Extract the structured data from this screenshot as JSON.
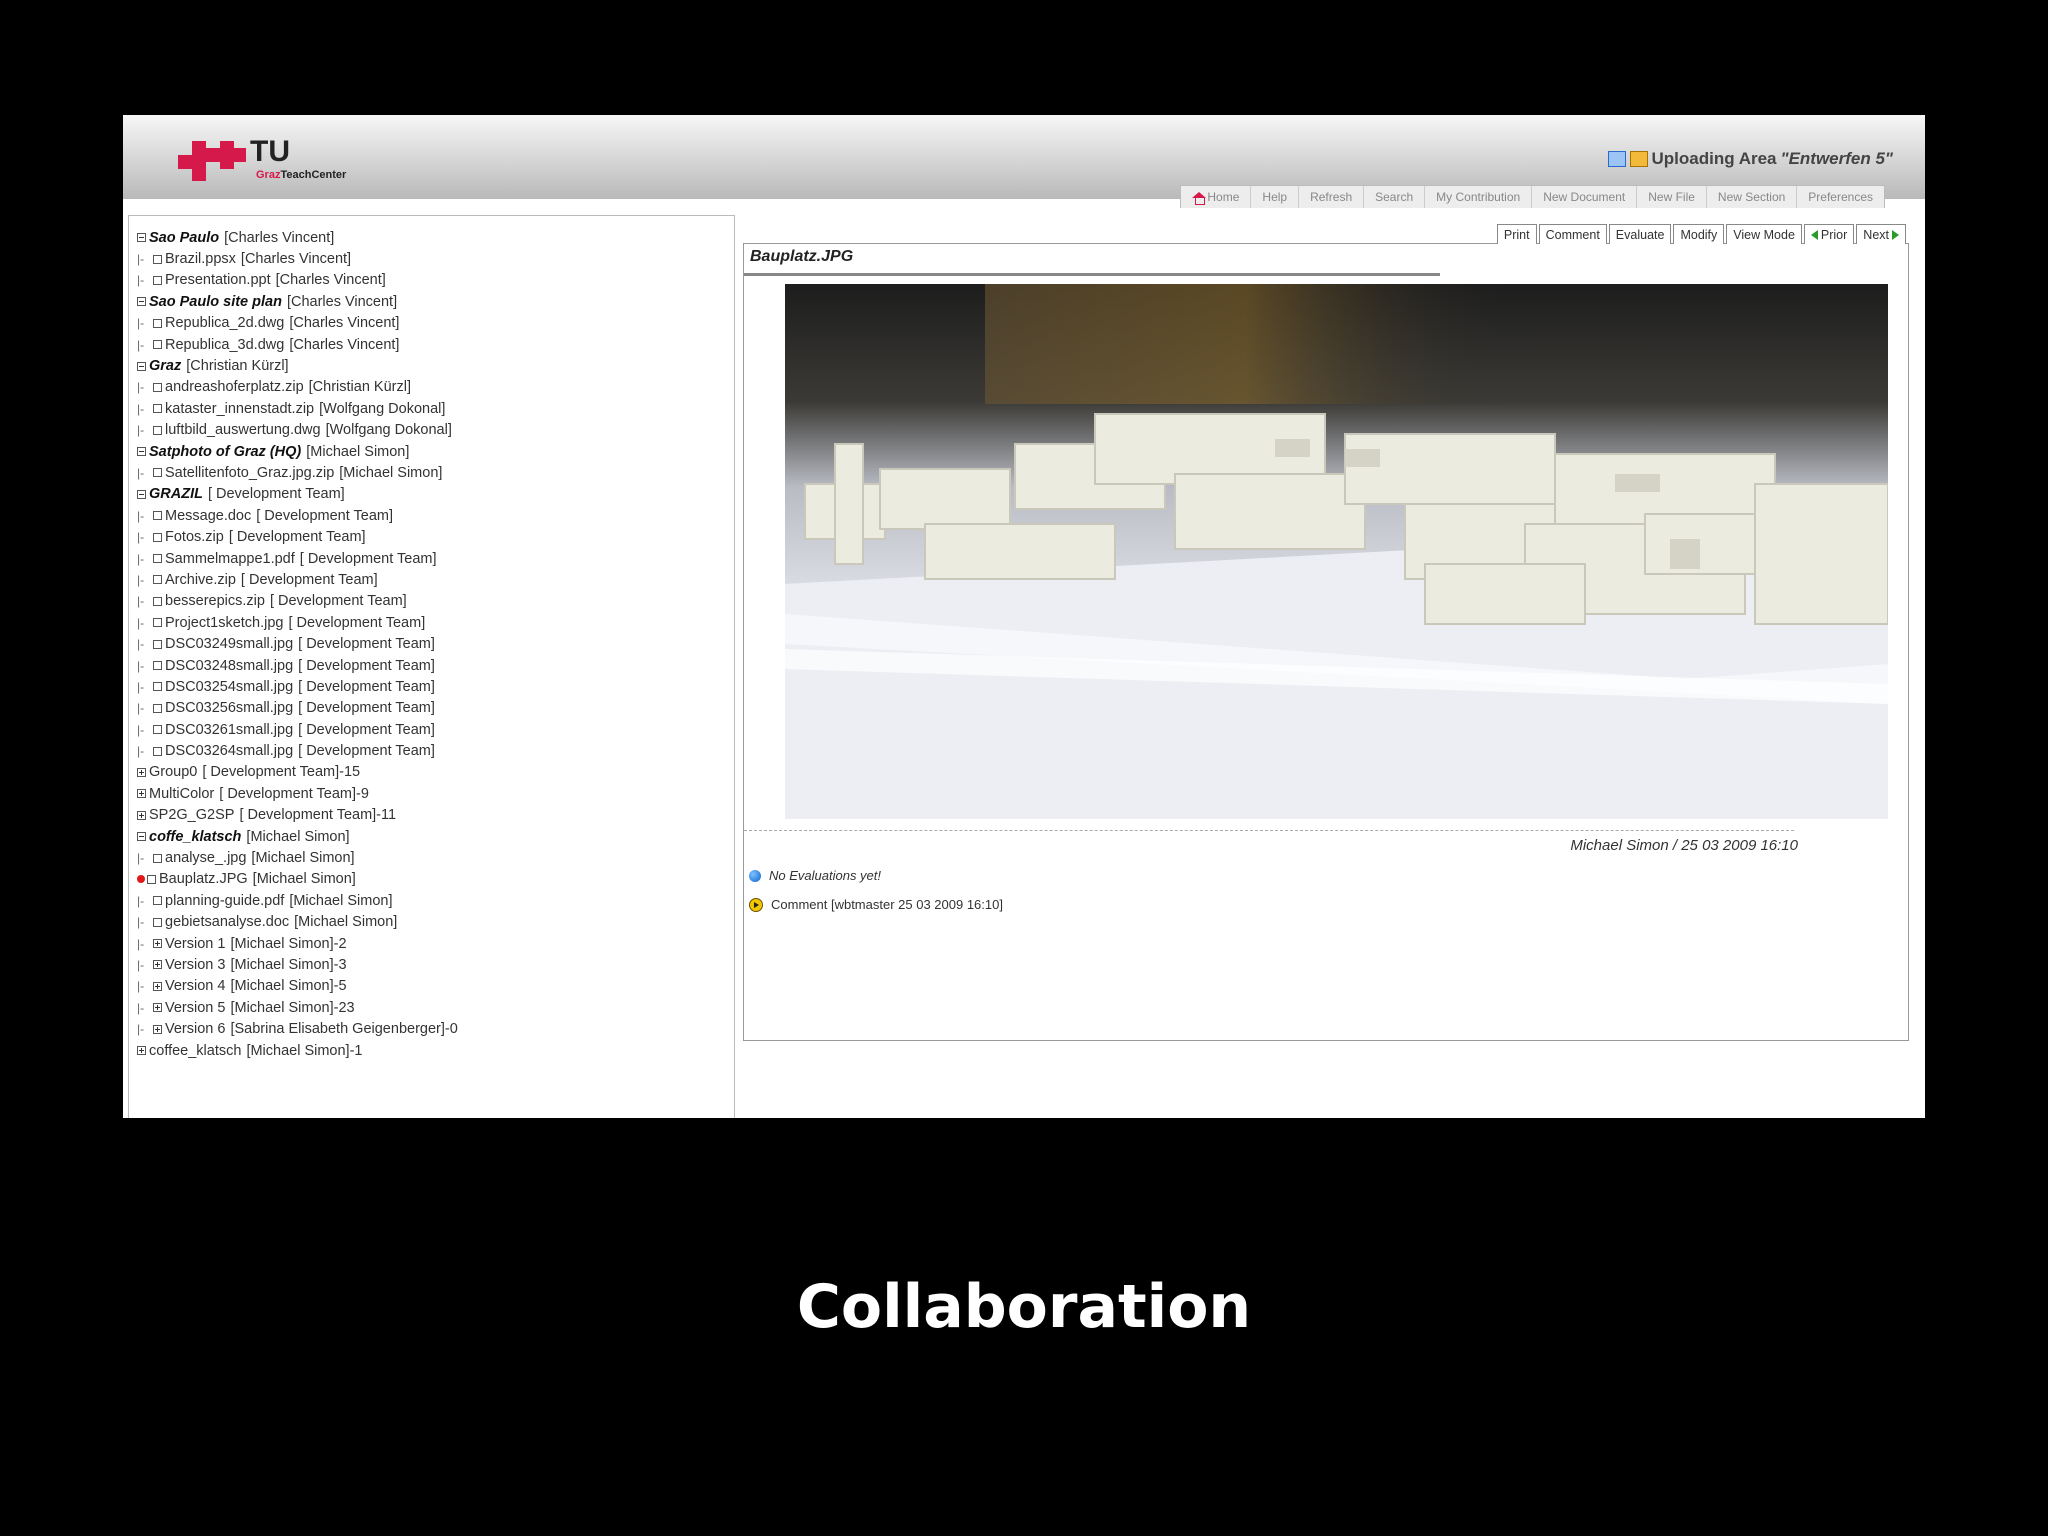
{
  "header": {
    "logo_text": "TU",
    "logo_sub_a": "Graz",
    "logo_sub_b": "TeachCenter",
    "area_label": "Uploading Area",
    "area_name": "\"Entwerfen 5\""
  },
  "nav": [
    "Home",
    "Help",
    "Refresh",
    "Search",
    "My Contribution",
    "New Document",
    "New File",
    "New Section",
    "Preferences"
  ],
  "tree": [
    {
      "pre": "",
      "box": "minus",
      "name": "Sao Paulo",
      "bold": true,
      "owner": "[Charles Vincent]"
    },
    {
      "pre": "|-",
      "box": "empty",
      "name": "Brazil.ppsx",
      "bold": false,
      "owner": "[Charles Vincent]"
    },
    {
      "pre": "|-",
      "box": "empty",
      "name": "Presentation.ppt",
      "bold": false,
      "owner": "[Charles Vincent]"
    },
    {
      "pre": "",
      "box": "minus",
      "name": "Sao Paulo site plan",
      "bold": true,
      "owner": "[Charles Vincent]"
    },
    {
      "pre": "|-",
      "box": "empty",
      "name": "Republica_2d.dwg",
      "bold": false,
      "owner": "[Charles Vincent]"
    },
    {
      "pre": "|-",
      "box": "empty",
      "name": "Republica_3d.dwg",
      "bold": false,
      "owner": "[Charles Vincent]"
    },
    {
      "pre": "",
      "box": "minus",
      "name": "Graz",
      "bold": true,
      "owner": "[Christian Kürzl]"
    },
    {
      "pre": "|-",
      "box": "empty",
      "name": "andreashoferplatz.zip",
      "bold": false,
      "owner": "[Christian Kürzl]"
    },
    {
      "pre": "|-",
      "box": "empty",
      "name": "kataster_innenstadt.zip",
      "bold": false,
      "owner": "[Wolfgang Dokonal]"
    },
    {
      "pre": "|-",
      "box": "empty",
      "name": "luftbild_auswertung.dwg",
      "bold": false,
      "owner": "[Wolfgang Dokonal]"
    },
    {
      "pre": "",
      "box": "minus",
      "name": "Satphoto of Graz (HQ)",
      "bold": true,
      "owner": "[Michael Simon]"
    },
    {
      "pre": "|-",
      "box": "empty",
      "name": "Satellitenfoto_Graz.jpg.zip",
      "bold": false,
      "owner": "[Michael Simon]"
    },
    {
      "pre": "",
      "box": "minus",
      "name": "GRAZIL",
      "bold": true,
      "owner": "[ Development Team]"
    },
    {
      "pre": "|-",
      "box": "empty",
      "name": "Message.doc",
      "bold": false,
      "owner": "[ Development Team]"
    },
    {
      "pre": "|-",
      "box": "empty",
      "name": "Fotos.zip",
      "bold": false,
      "owner": "[ Development Team]"
    },
    {
      "pre": "|-",
      "box": "empty",
      "name": "Sammelmappe1.pdf",
      "bold": false,
      "owner": "[ Development Team]"
    },
    {
      "pre": "|-",
      "box": "empty",
      "name": "Archive.zip",
      "bold": false,
      "owner": "[ Development Team]"
    },
    {
      "pre": "|-",
      "box": "empty",
      "name": "besserepics.zip",
      "bold": false,
      "owner": "[ Development Team]"
    },
    {
      "pre": "|-",
      "box": "empty",
      "name": "Project1sketch.jpg",
      "bold": false,
      "owner": "[ Development Team]"
    },
    {
      "pre": "|-",
      "box": "empty",
      "name": "DSC03249small.jpg",
      "bold": false,
      "owner": "[ Development Team]"
    },
    {
      "pre": "|-",
      "box": "empty",
      "name": "DSC03248small.jpg",
      "bold": false,
      "owner": "[ Development Team]"
    },
    {
      "pre": "|-",
      "box": "empty",
      "name": "DSC03254small.jpg",
      "bold": false,
      "owner": "[ Development Team]"
    },
    {
      "pre": "|-",
      "box": "empty",
      "name": "DSC03256small.jpg",
      "bold": false,
      "owner": "[ Development Team]"
    },
    {
      "pre": "|-",
      "box": "empty",
      "name": "DSC03261small.jpg",
      "bold": false,
      "owner": "[ Development Team]"
    },
    {
      "pre": "|-",
      "box": "empty",
      "name": "DSC03264small.jpg",
      "bold": false,
      "owner": "[ Development Team]"
    },
    {
      "pre": "",
      "box": "plus",
      "name": "Group0",
      "bold": false,
      "owner": "[ Development Team]-15"
    },
    {
      "pre": "",
      "box": "plus",
      "name": "MultiColor",
      "bold": false,
      "owner": "[ Development Team]-9"
    },
    {
      "pre": "",
      "box": "plus",
      "name": "SP2G_G2SP",
      "bold": false,
      "owner": "[ Development Team]-11"
    },
    {
      "pre": "",
      "box": "minus",
      "name": "coffe_klatsch",
      "bold": true,
      "owner": "[Michael Simon]"
    },
    {
      "pre": "|-",
      "box": "empty",
      "name": "analyse_.jpg",
      "bold": false,
      "owner": "[Michael Simon]"
    },
    {
      "pre": "|-",
      "box": "empty",
      "name": "Bauplatz.JPG",
      "bold": false,
      "owner": "[Michael Simon]",
      "selected": true
    },
    {
      "pre": "|-",
      "box": "empty",
      "name": "planning-guide.pdf",
      "bold": false,
      "owner": "[Michael Simon]"
    },
    {
      "pre": "|-",
      "box": "empty",
      "name": "gebietsanalyse.doc",
      "bold": false,
      "owner": "[Michael Simon]"
    },
    {
      "pre": "|-",
      "box": "plus",
      "name": "Version 1",
      "bold": false,
      "owner": "[Michael Simon]-2"
    },
    {
      "pre": "|-",
      "box": "plus",
      "name": "Version 3",
      "bold": false,
      "owner": "[Michael Simon]-3"
    },
    {
      "pre": "|-",
      "box": "plus",
      "name": "Version 4",
      "bold": false,
      "owner": "[Michael Simon]-5"
    },
    {
      "pre": "|-",
      "box": "plus",
      "name": "Version 5",
      "bold": false,
      "owner": "[Michael Simon]-23"
    },
    {
      "pre": "|-",
      "box": "plus",
      "name": "Version 6",
      "bold": false,
      "owner": "[Sabrina Elisabeth Geigenberger]-0"
    },
    {
      "pre": "",
      "box": "plus",
      "name": "coffee_klatsch",
      "bold": false,
      "owner": "[Michael Simon]-1"
    }
  ],
  "viewer": {
    "tabs": [
      "Print",
      "Comment",
      "Evaluate",
      "Modify",
      "View Mode",
      "Prior",
      "Next"
    ],
    "file_title": "Bauplatz.JPG",
    "author_line": "Michael Simon / 25 03 2009 16:10",
    "evaluations": "No Evaluations yet!",
    "comment": "Comment [wbtmaster 25 03 2009 16:10]"
  },
  "caption": "Collaboration",
  "colors": {
    "brand": "#d6194b",
    "selected_marker": "#e01818"
  }
}
